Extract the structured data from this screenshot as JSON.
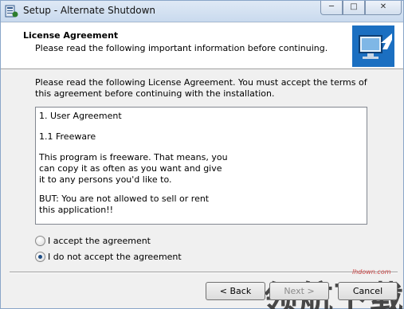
{
  "window": {
    "title": "Setup - Alternate Shutdown",
    "controls": {
      "minimize": "─",
      "maximize": "□",
      "close": "✕"
    }
  },
  "header": {
    "title": "License Agreement",
    "subtitle": "Please read the following important information before continuing.",
    "logo_icon": "monitor-arrow-icon"
  },
  "intro": {
    "text": "Please read the following License Agreement. You must accept the terms of this agreement before continuing with the installation."
  },
  "license": {
    "lines": [
      "1. User Agreement",
      "1.1 Freeware",
      "This program is freeware. That means, you",
      "can copy it as often as you want and give",
      "it to any persons you'd like to.",
      "BUT: You are not allowed to sell or rent",
      "this application!!"
    ]
  },
  "options": {
    "accept": {
      "label": "I accept the agreement",
      "selected": false
    },
    "decline": {
      "label": "I do not accept the agreement",
      "selected": true
    }
  },
  "buttons": {
    "back": "< Back",
    "next": "Next >",
    "cancel": "Cancel"
  },
  "watermark": {
    "url": "lhdown.com",
    "logo": "领航下载"
  },
  "colors": {
    "accent": "#1f4d84",
    "logo_blue": "#1b6fc1"
  }
}
